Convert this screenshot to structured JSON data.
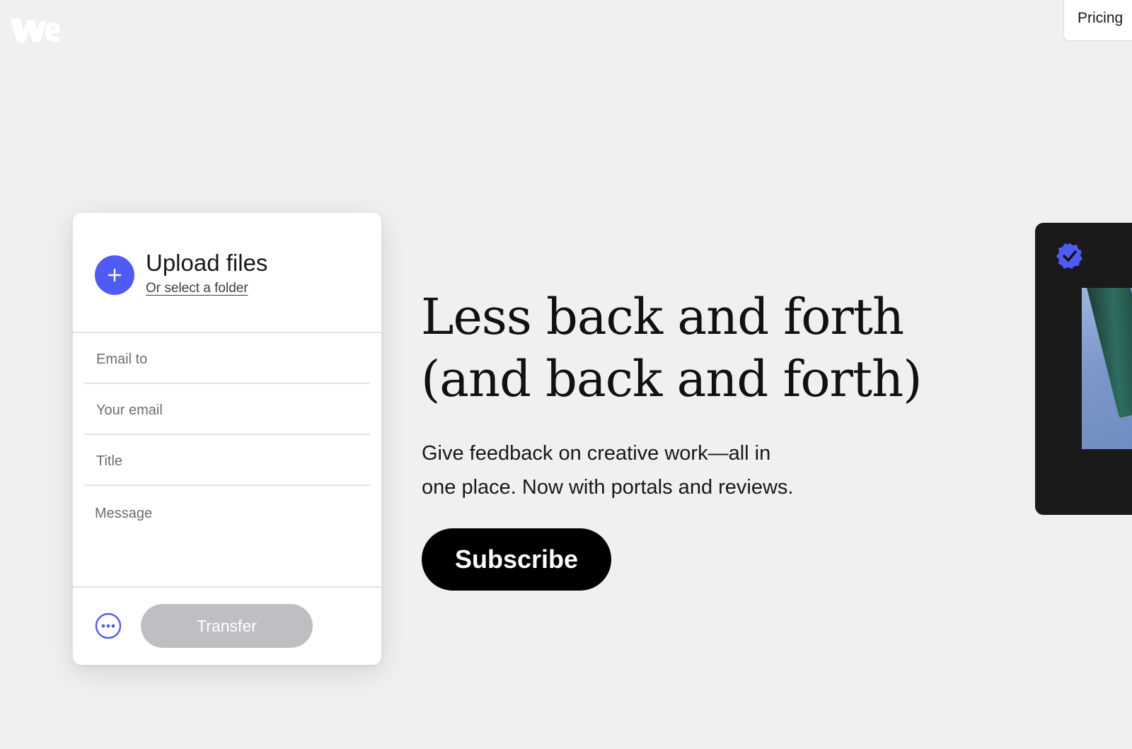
{
  "header": {
    "logo_icon": "wetransfer-logo-icon",
    "pricing_label": "Pricing"
  },
  "upload_panel": {
    "add_icon": "plus-icon",
    "title": "Upload files",
    "folder_link": "Or select a folder",
    "email_to_placeholder": "Email to",
    "your_email_placeholder": "Your email",
    "title_placeholder": "Title",
    "message_placeholder": "Message",
    "more_icon": "more-options-icon",
    "transfer_label": "Transfer"
  },
  "hero": {
    "headline_line1": "Less back and forth",
    "headline_line2": "(and back and forth)",
    "subtext_line1": "Give feedback on creative work—all in",
    "subtext_line2": "one place. Now with portals and reviews.",
    "subscribe_label": "Subscribe"
  },
  "preview_card": {
    "badge_icon": "verified-badge-icon"
  },
  "colors": {
    "background": "#f0f0f0",
    "accent": "#4f5cf3",
    "button_dark": "#000000",
    "transfer_disabled": "#bdbfc2"
  }
}
